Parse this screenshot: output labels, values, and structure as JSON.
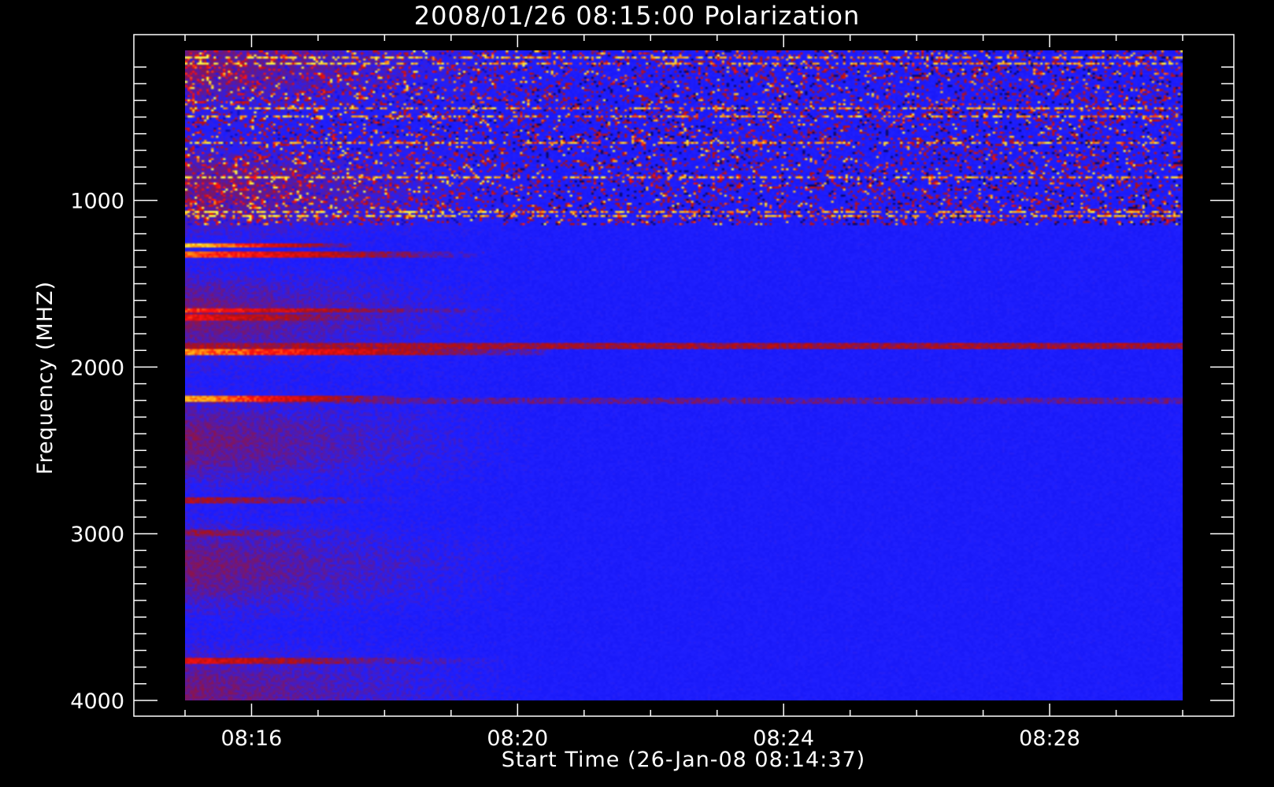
{
  "chart_data": {
    "type": "heatmap",
    "title": "2008/01/26 08:15:00 Polarization",
    "xlabel": "Start Time (26-Jan-08 08:14:37)",
    "ylabel": "Frequency (MHZ)",
    "x_tick_labels": [
      "08:16",
      "08:20",
      "08:24",
      "08:28"
    ],
    "x_ticks_minutes": [
      16,
      20,
      24,
      28
    ],
    "x_range_minutes": [
      15.0,
      30.0
    ],
    "y_tick_labels": [
      "1000",
      "2000",
      "3000",
      "4000"
    ],
    "y_ticks": [
      1000,
      2000,
      3000,
      4000
    ],
    "y_range": [
      100,
      4000
    ],
    "y_reversed": true,
    "colormap": [
      "#000000",
      "#1010f0",
      "#2020ff",
      "#b01010",
      "#ff1010",
      "#ffa010",
      "#ffff40"
    ],
    "background_color": "#000000",
    "foreground_color": "#ffffff",
    "features": [
      {
        "freq": 1270,
        "t_end": 17.5,
        "value": 0.95
      },
      {
        "freq": 1330,
        "t_end": 19.5,
        "value": 0.8
      },
      {
        "freq": 1660,
        "t_end": 19.8,
        "value": 0.75
      },
      {
        "freq": 1700,
        "t_end": 18.5,
        "value": 0.7
      },
      {
        "freq": 1870,
        "t_end": 30.0,
        "value": 0.7
      },
      {
        "freq": 1910,
        "t_end": 20.5,
        "value": 0.85
      },
      {
        "freq": 2190,
        "t_end": 18.2,
        "value": 0.9
      },
      {
        "freq": 2200,
        "t_end": 30.0,
        "value": 0.55
      },
      {
        "freq": 2800,
        "t_end": 19.0,
        "value": 0.55
      },
      {
        "freq": 3000,
        "t_end": 19.0,
        "value": 0.5
      },
      {
        "freq": 3760,
        "t_end": 20.0,
        "value": 0.65
      }
    ]
  }
}
